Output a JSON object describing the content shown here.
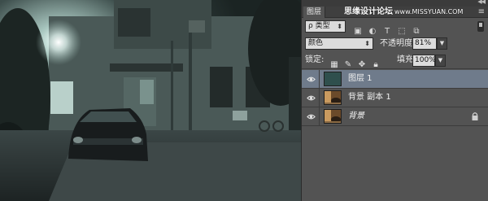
{
  "panel": {
    "tab_label": "图层",
    "watermark_text": "思缘设计论坛",
    "watermark_site": "www.MISSYUAN.COM",
    "menu_icon": "panel-menu-icon"
  },
  "filter": {
    "kind_label": "ρ 类型",
    "icons": [
      "image-filter-icon",
      "adjustment-filter-icon",
      "type-filter-icon",
      "shape-filter-icon",
      "smart-object-filter-icon"
    ]
  },
  "blend": {
    "mode": "颜色",
    "opacity_label": "不透明度:",
    "opacity_value": "81%"
  },
  "lock": {
    "label": "锁定:",
    "icons": [
      "lock-transparent-icon",
      "lock-image-icon",
      "lock-position-icon",
      "lock-all-icon"
    ],
    "fill_label": "填充:",
    "fill_value": "100%"
  },
  "layers": [
    {
      "name": "图层 1",
      "selected": true,
      "thumb": "solid-teal",
      "locked": false
    },
    {
      "name": "背景 副本 1",
      "selected": false,
      "thumb": "photo",
      "locked": false
    },
    {
      "name": "背景",
      "selected": false,
      "thumb": "photo",
      "locked": true
    }
  ],
  "colors": {
    "panel_bg": "#535353",
    "selected_row": "#6f7b8b",
    "fill_color_thumb": "#2f4f4d"
  }
}
